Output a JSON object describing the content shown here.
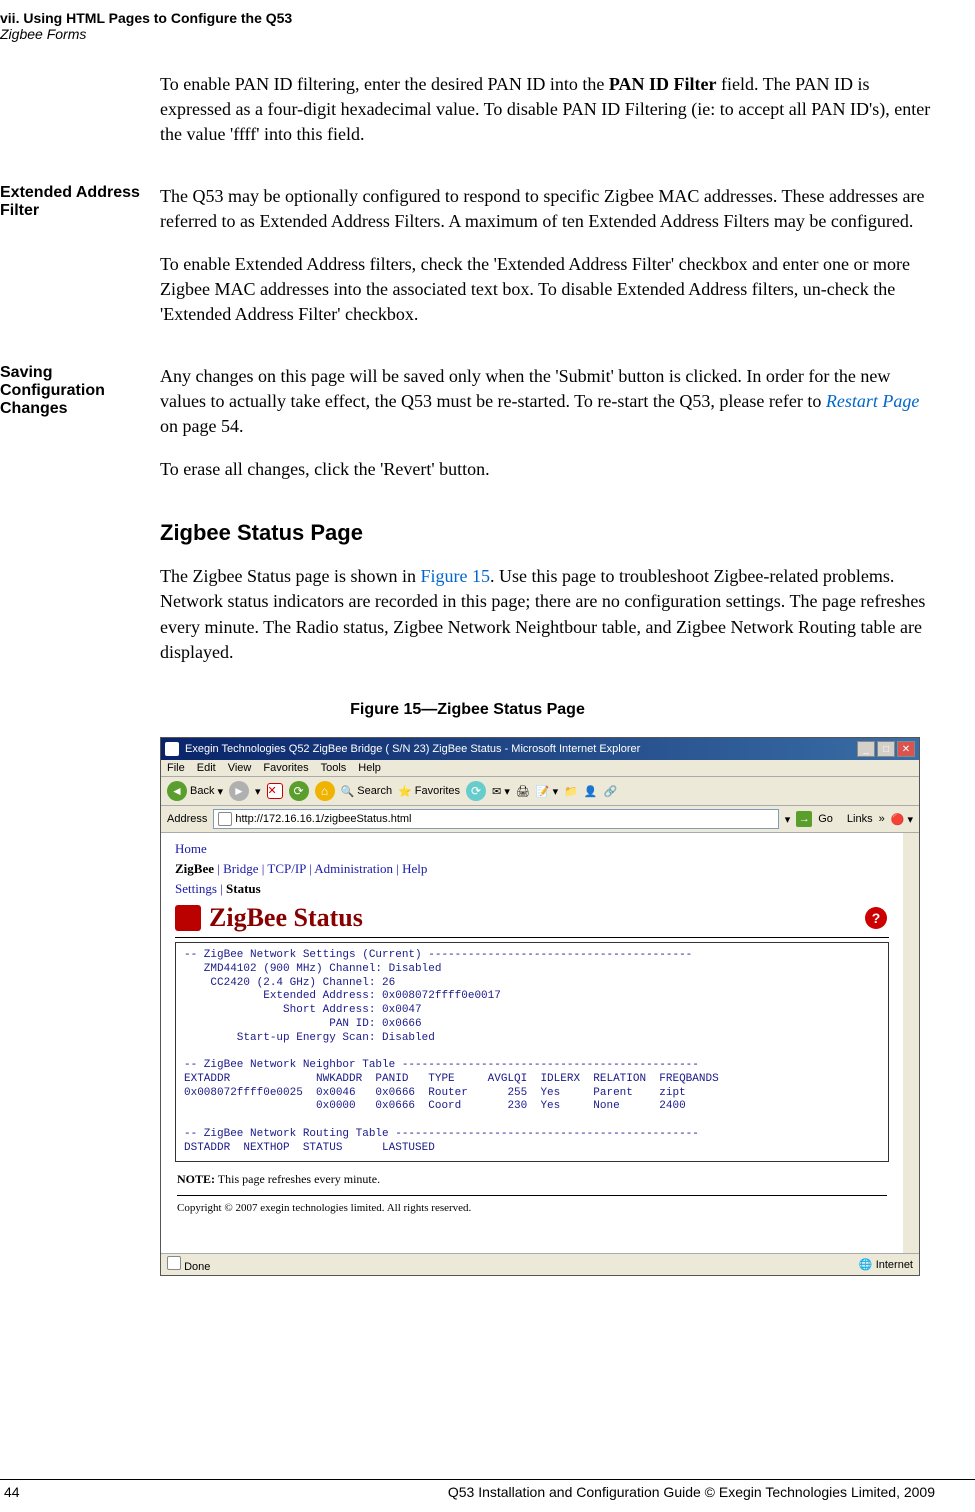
{
  "header": {
    "chapter": "vii. Using HTML Pages to Configure the Q53",
    "section": "Zigbee Forms"
  },
  "para_panid": {
    "pre": "To enable PAN ID filtering, enter the desired PAN ID into the ",
    "bold": "PAN ID Filter",
    "post": " field. The PAN ID is expressed as a four-digit hexadecimal value. To disable PAN ID Filtering (ie: to accept all PAN ID's), enter the value 'ffff' into this field."
  },
  "ext_addr": {
    "label": "Extended Address Filter",
    "p1": "The Q53 may be optionally configured to respond to specific Zigbee MAC addresses. These addresses are referred to as Extended Address Filters. A maximum of ten Extended Address Filters may be configured.",
    "p2": "To enable Extended Address filters, check the 'Extended Address Filter' checkbox and enter one or more Zigbee MAC addresses into the associated text box. To disable Extended Address filters, un-check the 'Extended Address Filter' checkbox."
  },
  "saving": {
    "label": "Saving Configuration Changes",
    "p1_pre": "Any changes on this page will be saved only when the 'Submit' button is clicked. In order for the new values to actually take effect, the Q53 must be re-started. To re-start the Q53, please refer to ",
    "p1_link": "Restart Page",
    "p1_post": " on page 54.",
    "p2": "To erase all changes, click the 'Revert' button."
  },
  "heading": "Zigbee Status Page",
  "status_para": {
    "pre": "The Zigbee Status page is shown in ",
    "link": "Figure 15",
    "post": ". Use this page to troubleshoot Zigbee-related problems. Network status indicators are recorded in this page; there are no configuration settings. The page refreshes every minute. The Radio status, Zigbee Network Neightbour table, and Zigbee Network Routing table are displayed."
  },
  "figure_caption": "Figure 15—Zigbee Status Page",
  "browser": {
    "title": "Exegin Technologies Q52 ZigBee Bridge ( S/N 23) ZigBee Status - Microsoft Internet Explorer",
    "menu": {
      "file": "File",
      "edit": "Edit",
      "view": "View",
      "favorites": "Favorites",
      "tools": "Tools",
      "help": "Help"
    },
    "toolbar": {
      "back": "Back",
      "search": "Search",
      "favorites": "Favorites"
    },
    "address_label": "Address",
    "url": "http://172.16.16.1/zigbeeStatus.html",
    "go": "Go",
    "links": "Links",
    "status_done": "Done",
    "status_zone": "Internet"
  },
  "webpage": {
    "nav1": {
      "home": "Home"
    },
    "nav2": {
      "zigbee": "ZigBee",
      "bridge": "Bridge",
      "tcpip": "TCP/IP",
      "admin": "Administration",
      "help": "Help"
    },
    "nav3": {
      "settings": "Settings",
      "status": "Status"
    },
    "title": "ZigBee Status",
    "pre_text": "-- ZigBee Network Settings (Current) ----------------------------------------\n   ZMD44102 (900 MHz) Channel: Disabled\n    CC2420 (2.4 GHz) Channel: 26\n            Extended Address: 0x008072ffff0e0017\n               Short Address: 0x0047\n                      PAN ID: 0x0666\n        Start-up Energy Scan: Disabled\n\n-- ZigBee Network Neighbor Table ---------------------------------------------\nEXTADDR             NWKADDR  PANID   TYPE     AVGLQI  IDLERX  RELATION  FREQBANDS\n0x008072ffff0e0025  0x0046   0x0666  Router      255  Yes     Parent    zipt\n                    0x0000   0x0666  Coord       230  Yes     None      2400\n\n-- ZigBee Network Routing Table ----------------------------------------------\nDSTADDR  NEXTHOP  STATUS      LASTUSED",
    "note_bold": "NOTE:",
    "note_text": " This page refreshes every minute.",
    "copyright": "Copyright © 2007 exegin technologies limited. All rights reserved."
  },
  "footer": {
    "page": "44",
    "center": "Q53 Installation and Configuration Guide  © Exegin Technologies Limited, 2009"
  }
}
